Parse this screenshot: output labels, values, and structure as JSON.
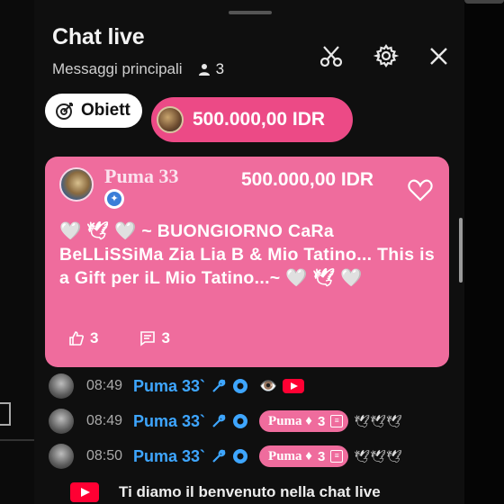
{
  "header": {
    "title": "Chat live",
    "subtitle": "Messaggi principali",
    "viewer_count": "3",
    "icons": [
      "scissors-icon",
      "gear-icon",
      "close-icon"
    ]
  },
  "chips": {
    "goal_label": "Obiett",
    "gift_amount": "500.000,00 IDR"
  },
  "supercard": {
    "name": "Puma 33",
    "amount": "500.000,00 IDR",
    "message": "🤍 🕊 🤍 ~ BUONGIORNO CaRa BeLLiSSiMa Zia Lia B & Mio Tatino... This is a Gift per iL Mio Tatino...~ 🤍 🕊 🤍",
    "likes": "3",
    "replies": "3",
    "color": "#ef6c9d"
  },
  "messages": [
    {
      "time": "08:49",
      "user": "Puma 33`",
      "content": "👁️"
    },
    {
      "time": "08:49",
      "user": "Puma 33`",
      "pill_name": "Puma ♦",
      "pill_count": "3",
      "trail": "🕊🕊🕊"
    },
    {
      "time": "08:50",
      "user": "Puma 33`",
      "pill_name": "Puma ♦",
      "pill_count": "3",
      "trail": "🕊🕊🕊"
    }
  ],
  "footer": {
    "welcome": "Ti diamo il benvenuto nella chat live"
  },
  "colors": {
    "accent_pink": "#ec4a86",
    "username_blue": "#3ea6ff",
    "background": "#0f0f0f"
  }
}
